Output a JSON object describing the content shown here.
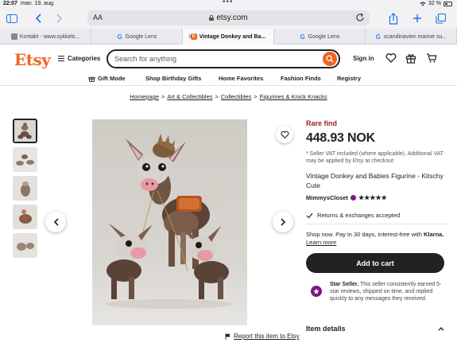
{
  "status_bar": {
    "time": "22:07",
    "date": "man. 19. aug.",
    "battery": "32 %"
  },
  "browser": {
    "text_size_label": "AA",
    "url": "etsy.com",
    "tabs": [
      {
        "label": "Kontakt - www.sykkels...",
        "icon": "generic-favicon",
        "active": false
      },
      {
        "label": "Google Lens",
        "icon": "google-icon",
        "active": false
      },
      {
        "label": "Vintage Donkey and Ba...",
        "icon": "etsy-favicon",
        "active": true
      },
      {
        "label": "Google Lens",
        "icon": "google-icon",
        "active": false
      },
      {
        "label": "scandinavien marine su...",
        "icon": "google-icon",
        "active": false
      }
    ]
  },
  "header": {
    "logo": "Etsy",
    "categories_label": "Categories",
    "search_placeholder": "Search for anything",
    "signin_label": "Sign in"
  },
  "nav": {
    "items": [
      "Gift Mode",
      "Shop Birthday Gifts",
      "Home Favorites",
      "Fashion Finds",
      "Registry"
    ]
  },
  "breadcrumb": [
    "Homepage",
    "Art & Collectibles",
    "Collectibles",
    "Figurines & Knick Knacks"
  ],
  "listing": {
    "badge": "Rare find",
    "price": "448.93 NOK",
    "vat_note": "* Seller VAT included (where applicable). Additional VAT may be applied by Etsy at checkout",
    "title": "Vintage Donkey and Babies Figurine - Kitschy Cute",
    "shop_name": "MimmysCloset",
    "stars": "★★★★★",
    "returns": "Returns & exchanges accepted",
    "klarna_text": "Shop now. Pay in 30 days, interest-free with",
    "klarna_brand": "Klarna.",
    "learn_more": "Learn more",
    "add_to_cart": "Add to cart",
    "star_seller_title": "Star Seller.",
    "star_seller_text": "This seller consistently earned 5-star reviews, shipped on time, and replied quickly to any messages they received.",
    "item_details": "Item details",
    "report": "Report this item to Etsy"
  },
  "colors": {
    "brand": "#f1641e",
    "rare": "#a61a2e",
    "star_seller": "#7f187f"
  }
}
